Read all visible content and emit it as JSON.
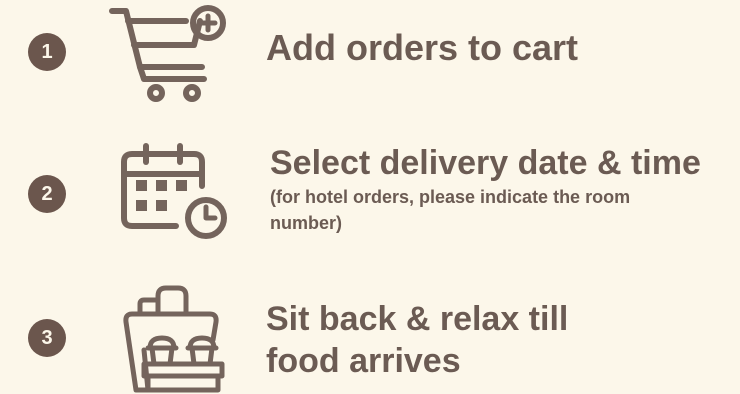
{
  "steps": [
    {
      "number": "1",
      "icon": "cart-plus-icon",
      "title": "Add orders to cart"
    },
    {
      "number": "2",
      "icon": "calendar-clock-icon",
      "title": "Select delivery date & time",
      "note_line1": "(for hotel orders, please indicate the room",
      "note_line2": "number)"
    },
    {
      "number": "3",
      "icon": "takeaway-bag-cups-icon",
      "title_line1": "Sit back & relax till",
      "title_line2": "food arrives"
    }
  ],
  "colors": {
    "background": "#fcf7ea",
    "circle": "#6b564d",
    "text": "#6b5b53",
    "icon_stroke": "#74645c"
  }
}
